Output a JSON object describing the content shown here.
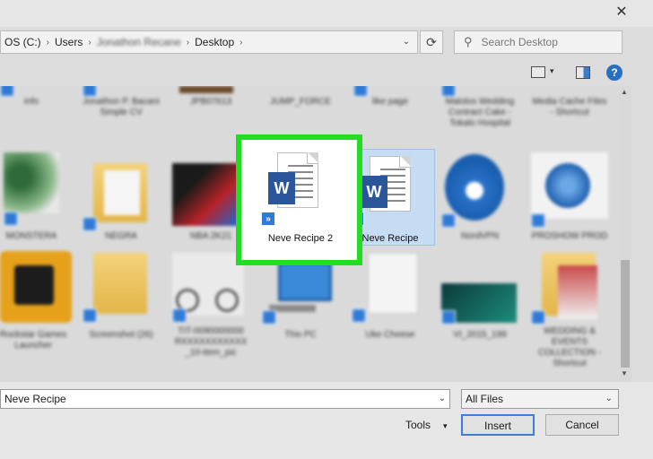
{
  "window": {
    "close_glyph": "✕"
  },
  "address": {
    "crumbs": [
      "OS (C:)",
      "Users",
      "Jonathon Recane",
      "Desktop"
    ],
    "chevron": "›",
    "dropdown": "⌄",
    "refresh_glyph": "⟳"
  },
  "search": {
    "placeholder": "Search Desktop",
    "icon": "search-icon"
  },
  "toolbar": {
    "view_menu_glyph": "▾",
    "help_glyph": "?"
  },
  "files": {
    "row0": [
      "info",
      "Jonathon P. Bacani Simple CV",
      "JPB07613",
      "JUMP_FORCE",
      "like page",
      "Malolos Wedding Contract Cake - Tokalo Hospital",
      "Media Cache Files - Shortcut"
    ],
    "row1": [
      "MONSTERA",
      "NEGRA",
      "NBA 2K21",
      "Neve Recipe 2",
      "Neve Recipe",
      "NordVPN",
      "PROSHOW PROD"
    ],
    "row2": [
      "Rockstar Games Launcher",
      "Screenshot (26)",
      "TIT-0090000000 RXXXXXXXXXXX _10-item_pic",
      "This PC",
      "Uke Cheese",
      "VI_2015_199",
      "WEDDING & EVENTS COLLECTION - Shortcut"
    ],
    "word_letter": "W",
    "shortcut_glyph": "»"
  },
  "footer": {
    "filename_value": "Neve Recipe",
    "filetype_value": "All Files",
    "dropdown_glyph": "⌄",
    "tools_label": "Tools",
    "tools_arrow": "▾",
    "insert_label": "Insert",
    "cancel_label": "Cancel"
  },
  "colors": {
    "highlight": "#22dd22",
    "word_blue": "#2b579a",
    "accent": "#3c7fd4"
  }
}
